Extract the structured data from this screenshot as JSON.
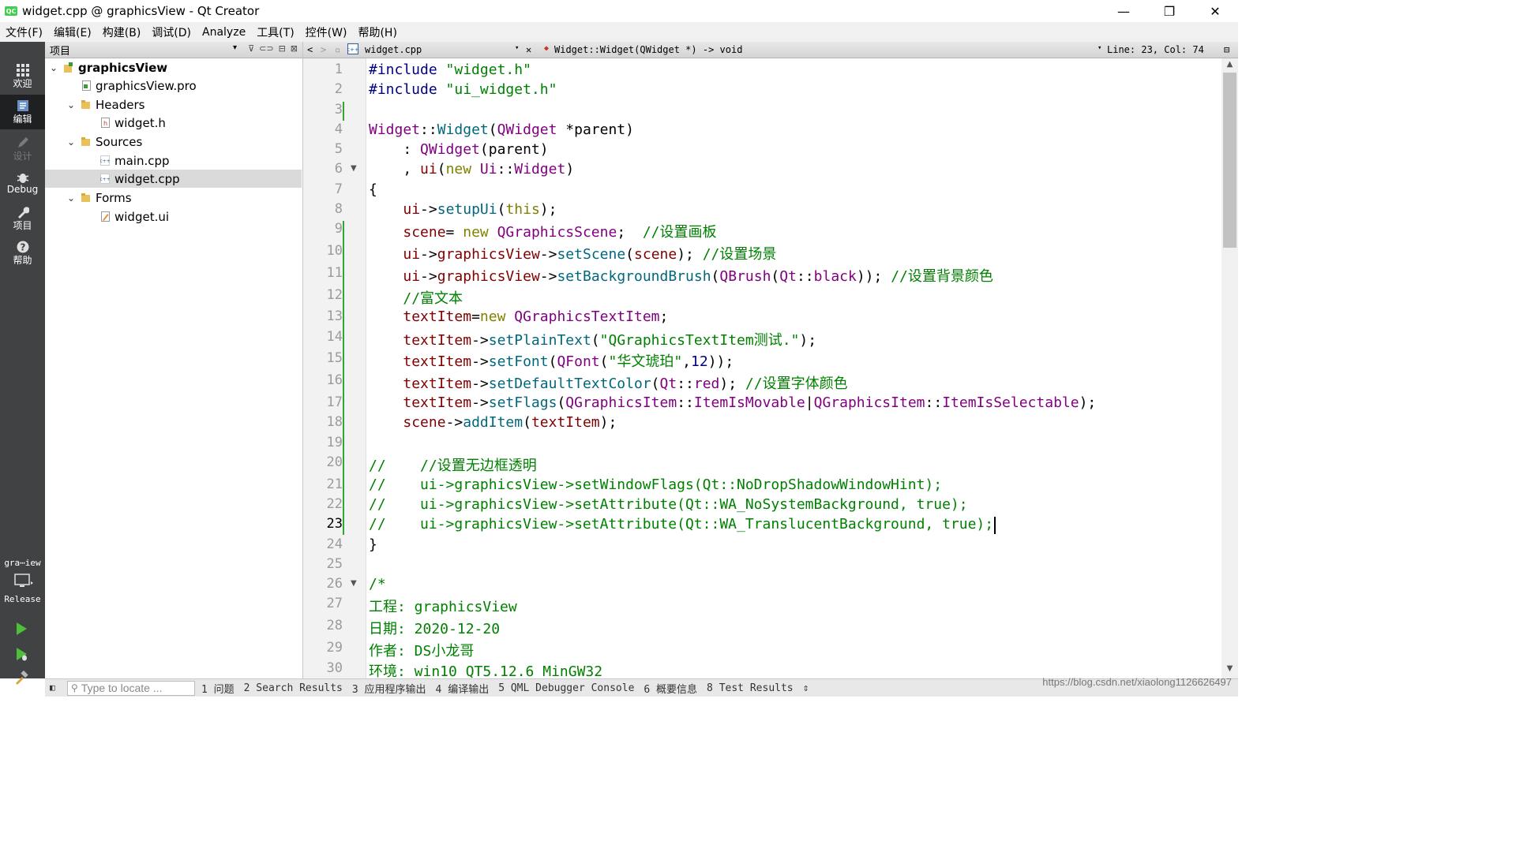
{
  "window": {
    "title": "widget.cpp @ graphicsView - Qt Creator",
    "app_icon_text": "QC",
    "minimize": "—",
    "restore": "❐",
    "close": "✕"
  },
  "menu": [
    "文件(F)",
    "编辑(E)",
    "构建(B)",
    "调试(D)",
    "Analyze",
    "工具(T)",
    "控件(W)",
    "帮助(H)"
  ],
  "modes": {
    "welcome": {
      "label": "欢迎",
      "icon": "grid-icon"
    },
    "edit": {
      "label": "编辑",
      "icon": "edit-icon"
    },
    "design": {
      "label": "设计",
      "icon": "pen-icon"
    },
    "debug": {
      "label": "Debug",
      "icon": "bug-icon"
    },
    "projects": {
      "label": "项目",
      "icon": "wrench-icon"
    },
    "help": {
      "label": "帮助",
      "icon": "help-icon"
    }
  },
  "kit": {
    "project": "gra⋯iew",
    "config": "Release"
  },
  "project_panel": {
    "header": "项目",
    "tree": [
      {
        "label": "graphicsView",
        "level": 0,
        "expanded": true,
        "bold": true,
        "icon": "project-icon"
      },
      {
        "label": "graphicsView.pro",
        "level": 1,
        "icon": "pro-file-icon"
      },
      {
        "label": "Headers",
        "level": 1,
        "expanded": true,
        "icon": "folder-icon"
      },
      {
        "label": "widget.h",
        "level": 2,
        "icon": "header-file-icon"
      },
      {
        "label": "Sources",
        "level": 1,
        "expanded": true,
        "icon": "folder-icon"
      },
      {
        "label": "main.cpp",
        "level": 2,
        "icon": "cpp-file-icon"
      },
      {
        "label": "widget.cpp",
        "level": 2,
        "selected": true,
        "icon": "cpp-file-icon"
      },
      {
        "label": "Forms",
        "level": 1,
        "expanded": true,
        "icon": "folder-icon"
      },
      {
        "label": "widget.ui",
        "level": 2,
        "icon": "ui-file-icon"
      }
    ]
  },
  "editor": {
    "file": "widget.cpp",
    "symbol": "Widget::Widget(QWidget *) -> void",
    "position": "Line: 23, Col: 74",
    "current_line": 23,
    "lines": [
      [
        [
          "#include ",
          "#000080"
        ],
        [
          "\"widget.h\"",
          "#008000"
        ]
      ],
      [
        [
          "#include ",
          "#000080"
        ],
        [
          "\"ui_widget.h\"",
          "#008000"
        ]
      ],
      [],
      [
        [
          "Widget",
          "#800080"
        ],
        [
          "::",
          "#000"
        ],
        [
          "Widget",
          "#00677c"
        ],
        [
          "(",
          "#000"
        ],
        [
          "QWidget",
          "#800080"
        ],
        [
          " *parent)",
          "#000"
        ]
      ],
      [
        [
          "    : ",
          "#000"
        ],
        [
          "QWidget",
          "#800080"
        ],
        [
          "(parent)",
          "#000"
        ]
      ],
      [
        [
          "    , ",
          "#000"
        ],
        [
          "ui",
          "#800000"
        ],
        [
          "(",
          "#000"
        ],
        [
          "new",
          "#808000"
        ],
        [
          " ",
          "#000"
        ],
        [
          "Ui",
          "#800080"
        ],
        [
          "::",
          "#000"
        ],
        [
          "Widget",
          "#800080"
        ],
        [
          ")",
          "#000"
        ]
      ],
      [
        [
          "{",
          "#000"
        ]
      ],
      [
        [
          "    ",
          "#000"
        ],
        [
          "ui",
          "#800000"
        ],
        [
          "->",
          "#000"
        ],
        [
          "setupUi",
          "#00677c"
        ],
        [
          "(",
          "#000"
        ],
        [
          "this",
          "#808000"
        ],
        [
          ");",
          "#000"
        ]
      ],
      [
        [
          "    ",
          "#000"
        ],
        [
          "scene",
          "#800000"
        ],
        [
          "= ",
          "#000"
        ],
        [
          "new",
          "#808000"
        ],
        [
          " ",
          "#000"
        ],
        [
          "QGraphicsScene",
          "#800080"
        ],
        [
          ";  ",
          "#000"
        ],
        [
          "//设置画板",
          "#008000"
        ]
      ],
      [
        [
          "    ",
          "#000"
        ],
        [
          "ui",
          "#800000"
        ],
        [
          "->",
          "#000"
        ],
        [
          "graphicsView",
          "#800000"
        ],
        [
          "->",
          "#000"
        ],
        [
          "setScene",
          "#00677c"
        ],
        [
          "(",
          "#000"
        ],
        [
          "scene",
          "#800000"
        ],
        [
          "); ",
          "#000"
        ],
        [
          "//设置场景",
          "#008000"
        ]
      ],
      [
        [
          "    ",
          "#000"
        ],
        [
          "ui",
          "#800000"
        ],
        [
          "->",
          "#000"
        ],
        [
          "graphicsView",
          "#800000"
        ],
        [
          "->",
          "#000"
        ],
        [
          "setBackgroundBrush",
          "#00677c"
        ],
        [
          "(",
          "#000"
        ],
        [
          "QBrush",
          "#800080"
        ],
        [
          "(",
          "#000"
        ],
        [
          "Qt",
          "#800080"
        ],
        [
          "::",
          "#000"
        ],
        [
          "black",
          "#800080"
        ],
        [
          ")); ",
          "#000"
        ],
        [
          "//设置背景颜色",
          "#008000"
        ]
      ],
      [
        [
          "    ",
          "#000"
        ],
        [
          "//富文本",
          "#008000"
        ]
      ],
      [
        [
          "    ",
          "#000"
        ],
        [
          "textItem",
          "#800000"
        ],
        [
          "=",
          "#000"
        ],
        [
          "new",
          "#808000"
        ],
        [
          " ",
          "#000"
        ],
        [
          "QGraphicsTextItem",
          "#800080"
        ],
        [
          ";",
          "#000"
        ]
      ],
      [
        [
          "    ",
          "#000"
        ],
        [
          "textItem",
          "#800000"
        ],
        [
          "->",
          "#000"
        ],
        [
          "setPlainText",
          "#00677c"
        ],
        [
          "(",
          "#000"
        ],
        [
          "\"QGraphicsTextItem测试.\"",
          "#008000"
        ],
        [
          ");",
          "#000"
        ]
      ],
      [
        [
          "    ",
          "#000"
        ],
        [
          "textItem",
          "#800000"
        ],
        [
          "->",
          "#000"
        ],
        [
          "setFont",
          "#00677c"
        ],
        [
          "(",
          "#000"
        ],
        [
          "QFont",
          "#800080"
        ],
        [
          "(",
          "#000"
        ],
        [
          "\"华文琥珀\"",
          "#008000"
        ],
        [
          ",",
          "#000"
        ],
        [
          "12",
          "#000080"
        ],
        [
          "));",
          "#000"
        ]
      ],
      [
        [
          "    ",
          "#000"
        ],
        [
          "textItem",
          "#800000"
        ],
        [
          "->",
          "#000"
        ],
        [
          "setDefaultTextColor",
          "#00677c"
        ],
        [
          "(",
          "#000"
        ],
        [
          "Qt",
          "#800080"
        ],
        [
          "::",
          "#000"
        ],
        [
          "red",
          "#800080"
        ],
        [
          "); ",
          "#000"
        ],
        [
          "//设置字体颜色",
          "#008000"
        ]
      ],
      [
        [
          "    ",
          "#000"
        ],
        [
          "textItem",
          "#800000"
        ],
        [
          "->",
          "#000"
        ],
        [
          "setFlags",
          "#00677c"
        ],
        [
          "(",
          "#000"
        ],
        [
          "QGraphicsItem",
          "#800080"
        ],
        [
          "::",
          "#000"
        ],
        [
          "ItemIsMovable",
          "#800080"
        ],
        [
          "|",
          "#000"
        ],
        [
          "QGraphicsItem",
          "#800080"
        ],
        [
          "::",
          "#000"
        ],
        [
          "ItemIsSelectable",
          "#800080"
        ],
        [
          ");",
          "#000"
        ]
      ],
      [
        [
          "    ",
          "#000"
        ],
        [
          "scene",
          "#800000"
        ],
        [
          "->",
          "#000"
        ],
        [
          "addItem",
          "#00677c"
        ],
        [
          "(",
          "#000"
        ],
        [
          "textItem",
          "#800000"
        ],
        [
          ");",
          "#000"
        ]
      ],
      [],
      [
        [
          "//    //设置无边框透明",
          "#008000"
        ]
      ],
      [
        [
          "//    ui->graphicsView->setWindowFlags(Qt::NoDropShadowWindowHint);",
          "#008000"
        ]
      ],
      [
        [
          "//    ui->graphicsView->setAttribute(Qt::WA_NoSystemBackground, true);",
          "#008000"
        ]
      ],
      [
        [
          "//    ui->graphicsView->setAttribute(Qt::WA_TranslucentBackground, true);",
          "#008000"
        ]
      ],
      [
        [
          "}",
          "#000"
        ]
      ],
      [],
      [
        [
          "/*",
          "#008000"
        ]
      ],
      [
        [
          "工程: graphicsView",
          "#008000"
        ]
      ],
      [
        [
          "日期: 2020-12-20",
          "#008000"
        ]
      ],
      [
        [
          "作者: DS小龙哥",
          "#008000"
        ]
      ],
      [
        [
          "环境: win10 QT5.12.6 MinGW32",
          "#008000"
        ]
      ]
    ]
  },
  "status": {
    "locate_placeholder": "Type to locate ...",
    "tabs": [
      "1 问题",
      "2 Search Results",
      "3 应用程序输出",
      "4 编译输出",
      "5 QML Debugger Console",
      "6 概要信息",
      "8 Test Results"
    ],
    "watermark": "https://blog.csdn.net/xiaolong1126626497"
  }
}
